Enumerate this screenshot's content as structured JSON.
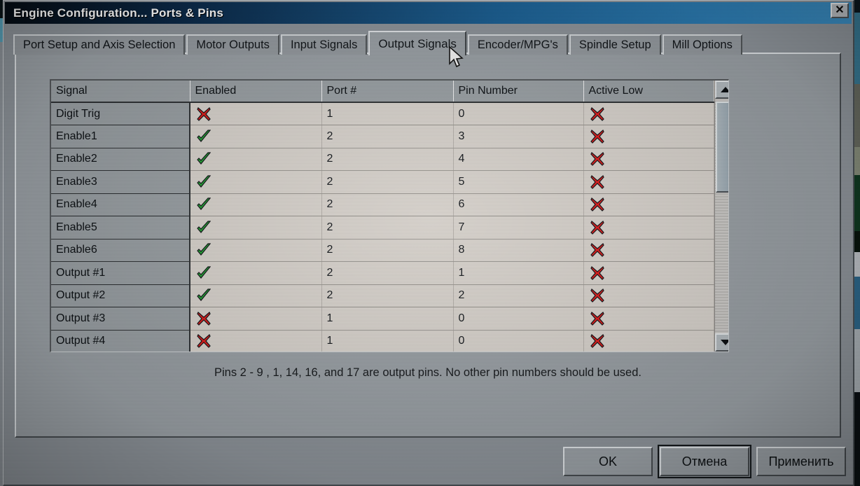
{
  "window": {
    "title": "Engine Configuration... Ports & Pins",
    "close_label": "✕"
  },
  "tabs": [
    {
      "label": "Port Setup and Axis Selection",
      "active": false
    },
    {
      "label": "Motor Outputs",
      "active": false
    },
    {
      "label": "Input Signals",
      "active": false
    },
    {
      "label": "Output Signals",
      "active": true
    },
    {
      "label": "Encoder/MPG's",
      "active": false
    },
    {
      "label": "Spindle Setup",
      "active": false
    },
    {
      "label": "Mill Options",
      "active": false
    }
  ],
  "grid": {
    "columns": [
      "Signal",
      "Enabled",
      "Port #",
      "Pin Number",
      "Active Low"
    ],
    "rows": [
      {
        "signal": "Digit  Trig",
        "enabled": "cross",
        "port": "1",
        "pin": "0",
        "active_low": "cross"
      },
      {
        "signal": "Enable1",
        "enabled": "check",
        "port": "2",
        "pin": "3",
        "active_low": "cross"
      },
      {
        "signal": "Enable2",
        "enabled": "check",
        "port": "2",
        "pin": "4",
        "active_low": "cross"
      },
      {
        "signal": "Enable3",
        "enabled": "check",
        "port": "2",
        "pin": "5",
        "active_low": "cross"
      },
      {
        "signal": "Enable4",
        "enabled": "check",
        "port": "2",
        "pin": "6",
        "active_low": "cross"
      },
      {
        "signal": "Enable5",
        "enabled": "check",
        "port": "2",
        "pin": "7",
        "active_low": "cross"
      },
      {
        "signal": "Enable6",
        "enabled": "check",
        "port": "2",
        "pin": "8",
        "active_low": "cross"
      },
      {
        "signal": "Output #1",
        "enabled": "check",
        "port": "2",
        "pin": "1",
        "active_low": "cross"
      },
      {
        "signal": "Output #2",
        "enabled": "check",
        "port": "2",
        "pin": "2",
        "active_low": "cross"
      },
      {
        "signal": "Output #3",
        "enabled": "cross",
        "port": "1",
        "pin": "0",
        "active_low": "cross"
      },
      {
        "signal": "Output #4",
        "enabled": "cross",
        "port": "1",
        "pin": "0",
        "active_low": "cross"
      }
    ]
  },
  "scrollbar": {
    "up_arrow": "scroll-up",
    "down_arrow": "scroll-down",
    "thumb_position_percent": 3
  },
  "hint": "Pins 2 - 9 , 1, 14, 16, and 17 are output pins. No  other pin numbers should be used.",
  "buttons": {
    "ok": "OK",
    "cancel": "Отмена",
    "apply": "Применить"
  },
  "colors": {
    "titlebar_start": "#050c14",
    "titlebar_end": "#3c8fc4",
    "dialog_face": "#8d9399",
    "tabpage_face": "#9aa0a5",
    "cell_face": "#d8d3cd",
    "signal_col_face": "#9aa0a4",
    "check_green": "#22a033",
    "cross_red": "#e01b1b"
  }
}
